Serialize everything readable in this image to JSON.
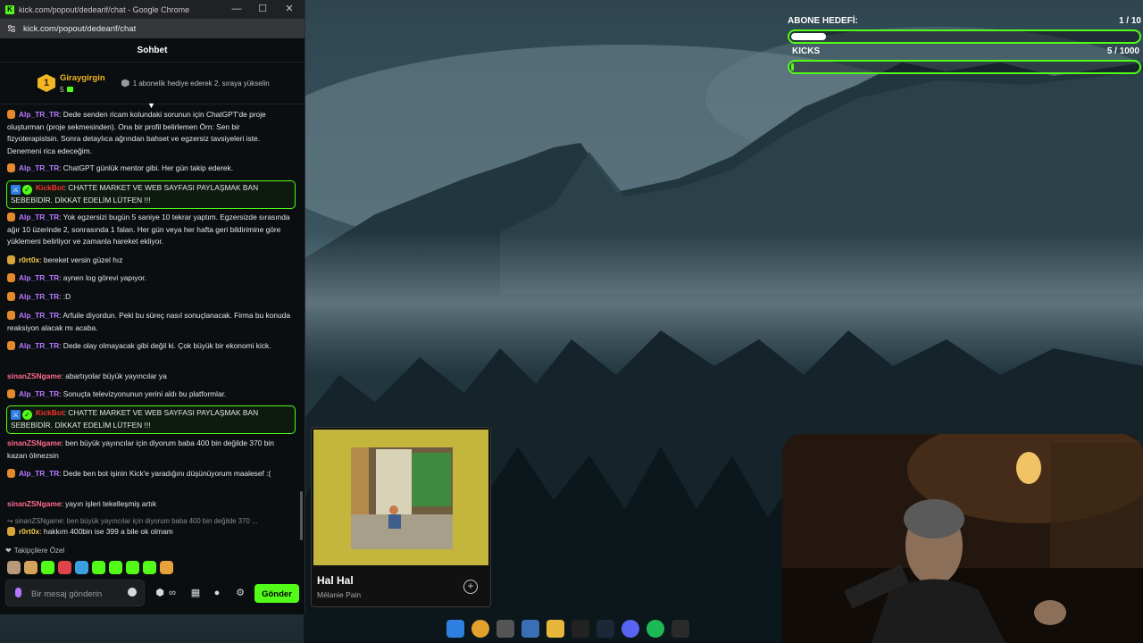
{
  "window": {
    "title": "kick.com/popout/dedearif/chat - Google Chrome",
    "url": "kick.com/popout/dedearif/chat"
  },
  "chat": {
    "header": "Sohbet",
    "leader": {
      "rank": "1",
      "name": "Giraygirgin",
      "count": "5",
      "tip": "1 abonelik hediye ederek 2. sıraya yükselin"
    },
    "messages": [
      {
        "user": "Alp_TR_TR",
        "text": ": Dede senden ricam kolundaki sorunun için ChatGPT'de proje oluşturman (proje sekmesinden). Ona bir profil belirlemen Örn: Sen bir fizyoterapistsin. Sonra detaylıca ağrından bahset ve egzersiz tavsiyeleri iste. Denemeni rica edeceğim."
      },
      {
        "user": "Alp_TR_TR",
        "text": ": ChatGPT günlük mentor gibi. Her gün takip ederek."
      },
      {
        "user": "KickBot",
        "text": ": CHATTE MARKET VE WEB SAYFASI PAYLAŞMAK BAN SEBEBİDİR. DİKKAT EDELİM LÜTFEN !!!"
      },
      {
        "user": "Alp_TR_TR",
        "text": ": Yok egzersizi bugün 5 saniye 10 tekrar yaptım. Egzersizde sırasında ağır 10 üzerinde 2, sonrasında 1 falan. Her gün veya her hafta geri bildirimine göre yüklemeni belirliyor ve zamanla hareket ekliyor."
      },
      {
        "user": "r0rt0x",
        "text": ": bereket versin güzel hız"
      },
      {
        "user": "Alp_TR_TR",
        "text": ": aynen log görevi yapıyor."
      },
      {
        "user": "Alp_TR_TR",
        "text": ": :D"
      },
      {
        "user": "Alp_TR_TR",
        "text": ": Arfuile diyordun. Peki bu süreç nasıl sonuçlanacak. Firma bu konuda reaksiyon alacak mı acaba."
      },
      {
        "user": "Alp_TR_TR",
        "text": ": Dede olay olmayacak gibi değil ki. Çok büyük bir ekonomi kick."
      },
      {
        "user": "sinanZSNgame",
        "text": ": abartıyolar büyük yayıncılar ya"
      },
      {
        "user": "Alp_TR_TR",
        "text": ": Sonuçta televizyonunun yerini aldı bu platformlar."
      },
      {
        "user": "KickBot",
        "text": ": CHATTE MARKET VE WEB SAYFASI PAYLAŞMAK BAN SEBEBİDİR. DİKKAT EDELİM LÜTFEN !!!"
      },
      {
        "user": "sinanZSNgame",
        "text": ": ben büyük yayıncılar için diyorum baba 400 bin değilde 370 bin kazan ölmezsin"
      },
      {
        "user": "Alp_TR_TR",
        "text": ": Dede ben bot işinin Kick'e yaradığını düşünüyorum maalesef :("
      },
      {
        "user": "sinanZSNgame",
        "text": ": yayın işleri tekelleşmiş artık"
      },
      {
        "reply": "sinanZSNgame: ben büyük yayıncılar için diyorum baba 400 bin değilde 370 ..."
      },
      {
        "user": "r0rt0x",
        "text": ": hakkım 400bin ise 399 a bile ok olmam"
      }
    ],
    "followers_label": "Takipçilere Özel",
    "input_placeholder": "Bir mesaj gönderin",
    "send_label": "Gönder"
  },
  "goal": {
    "sub_label": "ABONE HEDEFİ:",
    "sub_value": "1 / 10",
    "sub_progress": 0.1,
    "kicks_label": "KICKS",
    "kicks_value": "5 / 1000",
    "kicks_progress": 0.005
  },
  "music": {
    "track": "Hal Hal",
    "artist": "Mélanie Pain"
  },
  "colors": {
    "kick_green": "#53fc18",
    "username_purple": "#b478ff",
    "username_pink": "#ff6b8e",
    "username_gold": "#f6c945",
    "bot_red": "#ff2e2e"
  }
}
